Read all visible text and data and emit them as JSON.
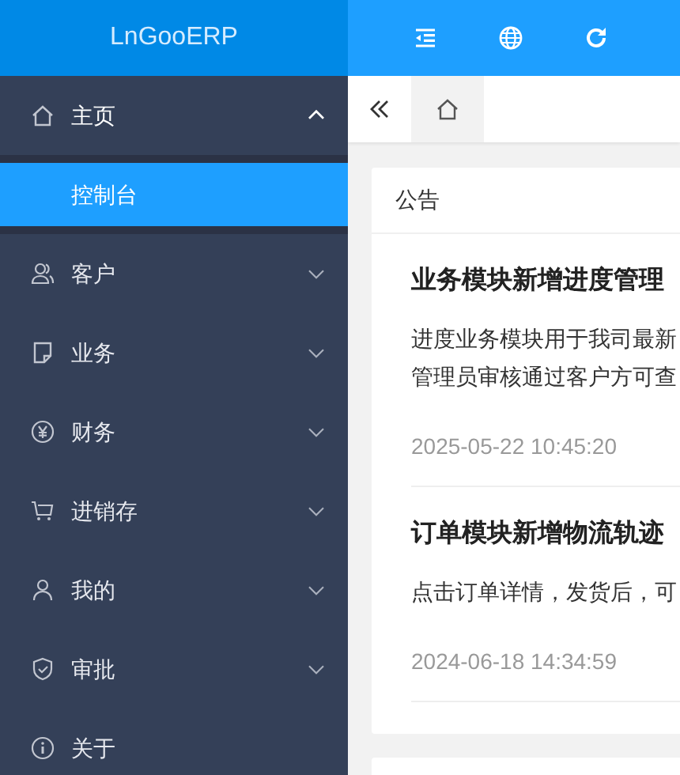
{
  "logo": "LnGooERP",
  "sidebar": {
    "items": [
      {
        "label": "主页",
        "expanded": true,
        "children": [
          {
            "label": "控制台",
            "selected": true
          }
        ]
      },
      {
        "label": "客户",
        "expanded": false
      },
      {
        "label": "业务",
        "expanded": false
      },
      {
        "label": "财务",
        "expanded": false
      },
      {
        "label": "进销存",
        "expanded": false
      },
      {
        "label": "我的",
        "expanded": false
      },
      {
        "label": "审批",
        "expanded": false
      },
      {
        "label": "关于"
      }
    ]
  },
  "tabs": [
    {
      "selected": true
    }
  ],
  "notice_card": {
    "title": "公告",
    "items": [
      {
        "title": "业务模块新增进度管理",
        "body_lines": [
          "进度业务模块用于我司最新",
          "管理员审核通过客户方可查"
        ],
        "date": "2025-05-22 10:45:20"
      },
      {
        "title": "订单模块新增物流轨迹",
        "body_lines": [
          "点击订单详情，发货后，可"
        ],
        "date": "2024-06-18 14:34:59"
      }
    ]
  }
}
